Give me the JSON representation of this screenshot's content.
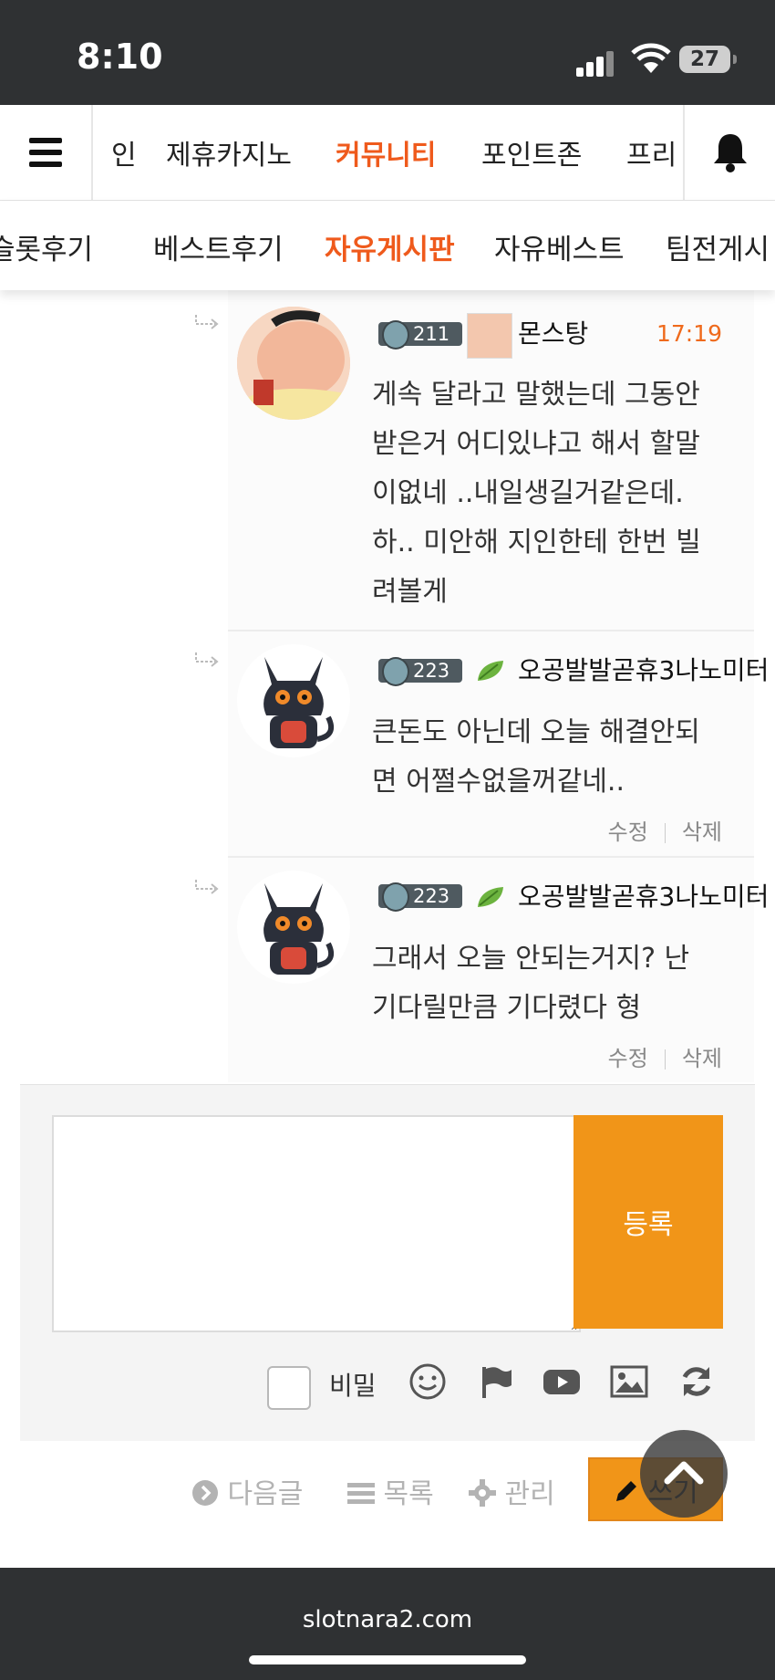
{
  "status": {
    "time": "8:10",
    "battery": "27"
  },
  "topnav": {
    "items": [
      "인",
      "제휴카지노",
      "커뮤니티",
      "포인트존",
      "프리"
    ],
    "active_index": 2
  },
  "subnav": {
    "items": [
      "슬롯후기",
      "베스트후기",
      "자유게시판",
      "자유베스트",
      "팀전게시"
    ],
    "active_index": 2
  },
  "comments": [
    {
      "level": "211",
      "author": "몬스탕",
      "time": "17:19",
      "text": "게속 달라고 말했는데 그동안 받은거 어디있냐고 해서 할말이없네 ..내일생길거같은데. 하.. 미안해 지인한테 한번 빌려볼게",
      "actions": []
    },
    {
      "level": "223",
      "author": "오공발발곧휴3나노미터",
      "time": "",
      "text": "큰돈도 아닌데 오늘 해결안되면 어쩔수없을꺼같네..",
      "actions": [
        "수정",
        "삭제"
      ]
    },
    {
      "level": "223",
      "author": "오공발발곧휴3나노미터",
      "time": "",
      "text": "그래서 오늘 안되는거지? 난 기다릴만큼 기다렸다 형",
      "actions": [
        "수정",
        "삭제"
      ]
    }
  ],
  "form": {
    "textarea_value": "",
    "submit_label": "등록",
    "secret_label": "비밀",
    "tools": [
      "emoji-icon",
      "flag-icon",
      "youtube-icon",
      "image-icon",
      "refresh-icon"
    ]
  },
  "bottom": {
    "next_label": "다음글",
    "list_label": "목록",
    "manage_label": "관리",
    "write_label": "쓰기"
  },
  "footer": {
    "domain": "slotnara2.com"
  },
  "colors": {
    "accent": "#ef5a1c",
    "button": "#f19518",
    "bar": "#2f3133"
  }
}
